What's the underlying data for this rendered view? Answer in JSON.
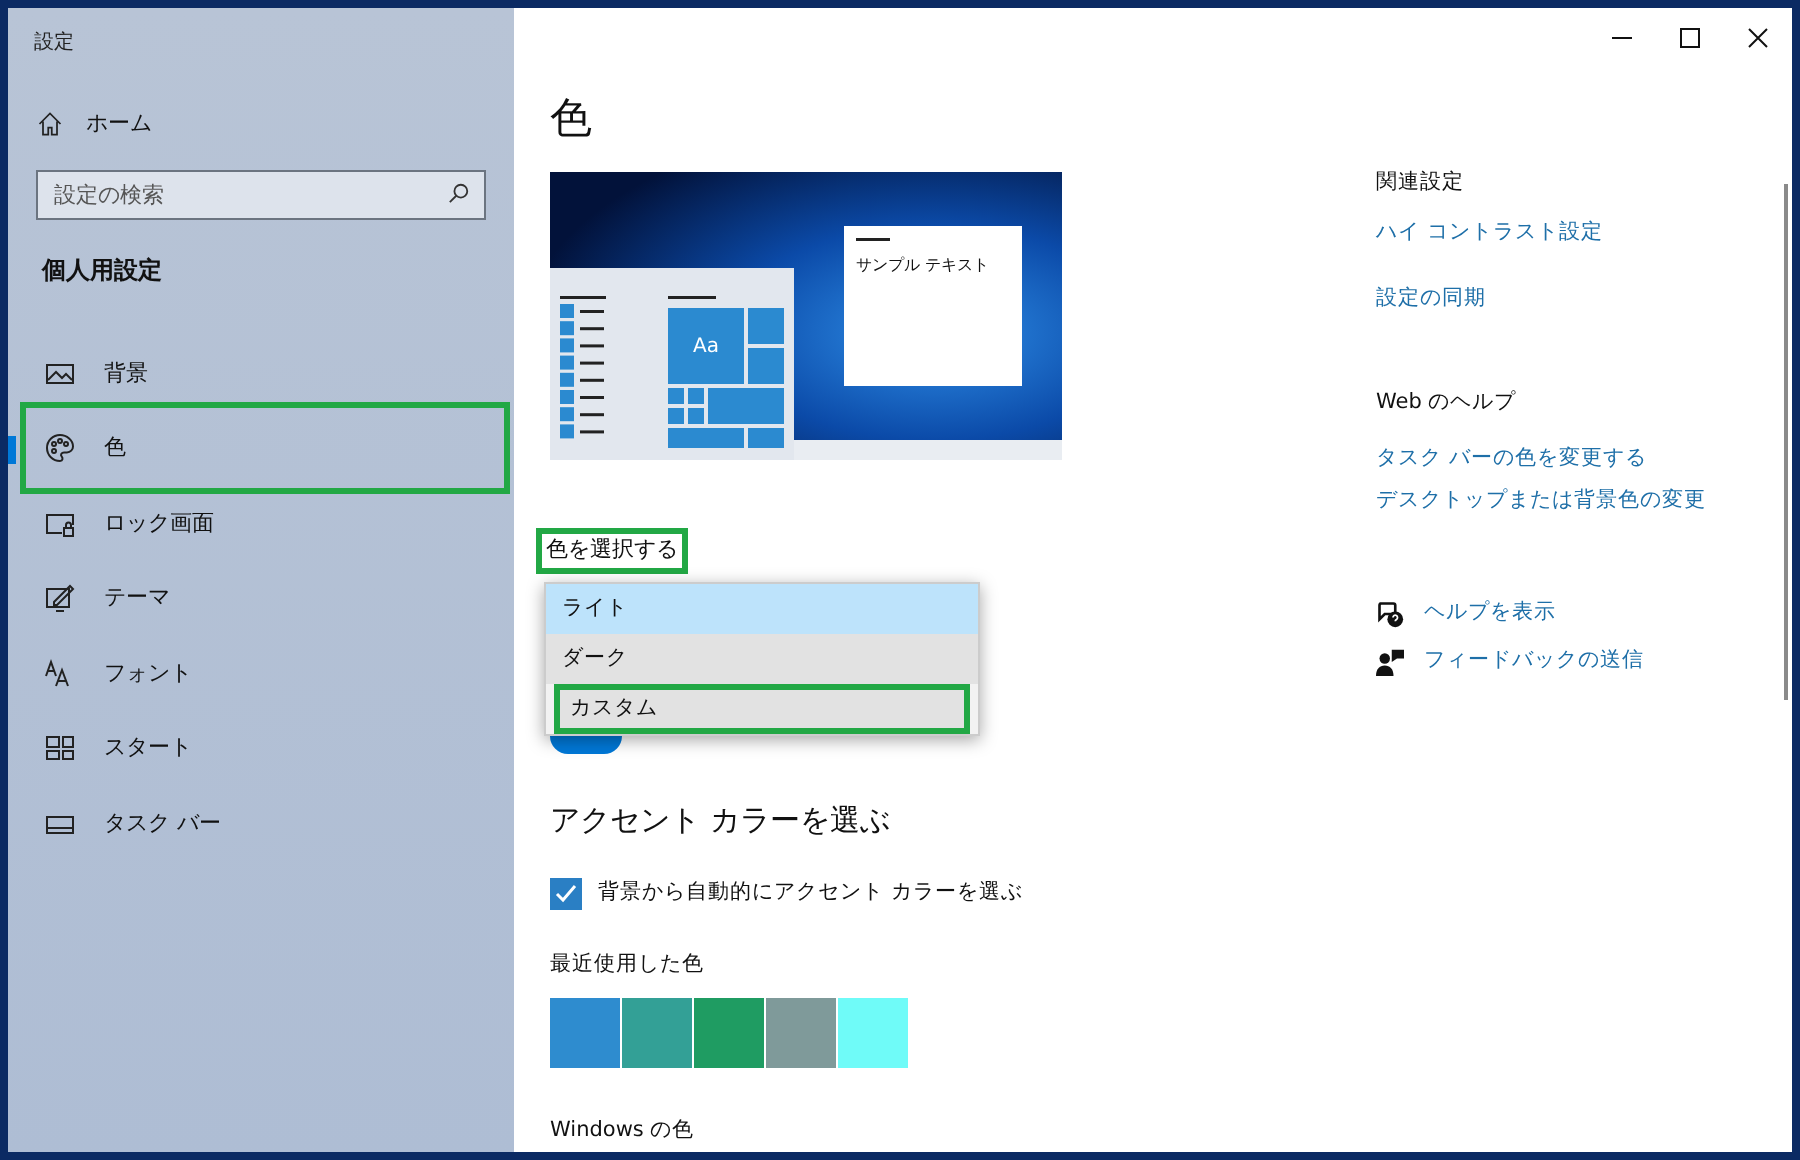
{
  "window": {
    "title": "設定"
  },
  "sidebar": {
    "home": "ホーム",
    "search": {
      "placeholder": "設定の検索"
    },
    "section": "個人用設定",
    "items": [
      {
        "label": "背景",
        "kind": "background",
        "selected": false,
        "highlighted": false
      },
      {
        "label": "色",
        "kind": "color",
        "selected": true,
        "highlighted": true
      },
      {
        "label": "ロック画面",
        "kind": "lock",
        "selected": false,
        "highlighted": false
      },
      {
        "label": "テーマ",
        "kind": "theme",
        "selected": false,
        "highlighted": false
      },
      {
        "label": "フォント",
        "kind": "font",
        "selected": false,
        "highlighted": false
      },
      {
        "label": "スタート",
        "kind": "start",
        "selected": false,
        "highlighted": false
      },
      {
        "label": "タスク バー",
        "kind": "taskbar",
        "selected": false,
        "highlighted": false
      }
    ]
  },
  "main": {
    "title": "色",
    "preview": {
      "sample_text": "サンプル テキスト",
      "tile_text": "Aa"
    },
    "color_select": {
      "label": "色を選択する",
      "highlighted": true,
      "options": [
        {
          "label": "ライト",
          "selected": true,
          "highlighted": false
        },
        {
          "label": "ダーク",
          "selected": false,
          "highlighted": false
        },
        {
          "label": "カスタム",
          "selected": false,
          "highlighted": true
        }
      ]
    },
    "toggle": {
      "on": true
    },
    "accent_heading": "アクセント カラーを選ぶ",
    "auto_accent": {
      "label": "背景から自動的にアクセント カラーを選ぶ",
      "checked": true
    },
    "recent_label": "最近使用した色",
    "recent_colors": [
      {
        "color": "#2e8ccf"
      },
      {
        "color": "#33a096"
      },
      {
        "color": "#1f9c62"
      },
      {
        "color": "#7f9a9a"
      },
      {
        "color": "#6ffbf8"
      }
    ],
    "windows_colors_label": "Windows の色"
  },
  "related": {
    "heading": "関連設定",
    "links": [
      "ハイ コントラスト設定",
      "設定の同期"
    ]
  },
  "web_help": {
    "heading": "Web のヘルプ",
    "links": [
      "タスク バーの色を変更する",
      "デスクトップまたは背景色の変更"
    ]
  },
  "support": [
    {
      "label": "ヘルプを表示",
      "kind": "help"
    },
    {
      "label": "フィードバックの送信",
      "kind": "feedback"
    }
  ]
}
